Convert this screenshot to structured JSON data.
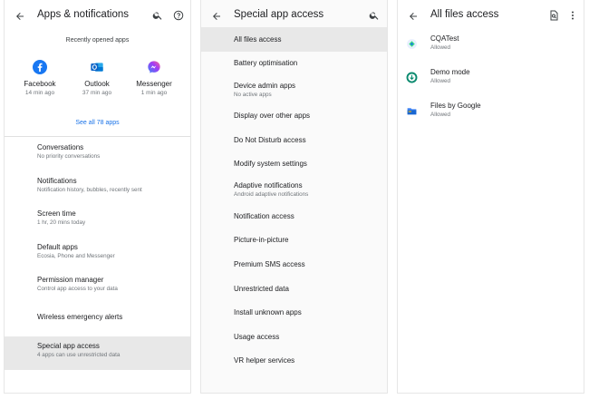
{
  "screen1": {
    "title": "Apps & notifications",
    "recent_title": "Recently opened apps",
    "recent_apps": [
      {
        "name": "Facebook",
        "time": "14 min ago",
        "icon": "facebook-icon"
      },
      {
        "name": "Outlook",
        "time": "37 min ago",
        "icon": "outlook-icon"
      },
      {
        "name": "Messenger",
        "time": "1 min ago",
        "icon": "messenger-icon"
      }
    ],
    "see_all": "See all 78 apps",
    "items": [
      {
        "title": "Conversations",
        "subtitle": "No priority conversations"
      },
      {
        "title": "Notifications",
        "subtitle": "Notification history, bubbles, recently sent"
      },
      {
        "title": "Screen time",
        "subtitle": "1 hr, 20 mins today"
      },
      {
        "title": "Default apps",
        "subtitle": "Ecosia, Phone and Messenger"
      },
      {
        "title": "Permission manager",
        "subtitle": "Control app access to your data"
      },
      {
        "title": "Wireless emergency alerts",
        "subtitle": ""
      },
      {
        "title": "Special app access",
        "subtitle": "4 apps can use unrestricted data"
      }
    ]
  },
  "screen2": {
    "title": "Special app access",
    "items": [
      {
        "title": "All files access",
        "subtitle": ""
      },
      {
        "title": "Battery optimisation",
        "subtitle": ""
      },
      {
        "title": "Device admin apps",
        "subtitle": "No active apps"
      },
      {
        "title": "Display over other apps",
        "subtitle": ""
      },
      {
        "title": "Do Not Disturb access",
        "subtitle": ""
      },
      {
        "title": "Modify system settings",
        "subtitle": ""
      },
      {
        "title": "Adaptive notifications",
        "subtitle": "Android adaptive notifications"
      },
      {
        "title": "Notification access",
        "subtitle": ""
      },
      {
        "title": "Picture-in-picture",
        "subtitle": ""
      },
      {
        "title": "Premium SMS access",
        "subtitle": ""
      },
      {
        "title": "Unrestricted data",
        "subtitle": ""
      },
      {
        "title": "Install unknown apps",
        "subtitle": ""
      },
      {
        "title": "Usage access",
        "subtitle": ""
      },
      {
        "title": "VR helper services",
        "subtitle": ""
      }
    ]
  },
  "screen3": {
    "title": "All files access",
    "items": [
      {
        "title": "CQATest",
        "subtitle": "Allowed",
        "icon": "cqatest-icon"
      },
      {
        "title": "Demo mode",
        "subtitle": "Allowed",
        "icon": "demo-mode-icon"
      },
      {
        "title": "Files by Google",
        "subtitle": "Allowed",
        "icon": "files-by-google-icon"
      }
    ]
  },
  "colors": {
    "accent": "#1a73e8",
    "selected_bg": "#e8e8e8",
    "facebook": "#1877f2",
    "outlook": "#0a64c8",
    "messenger": "#a33bf5"
  }
}
